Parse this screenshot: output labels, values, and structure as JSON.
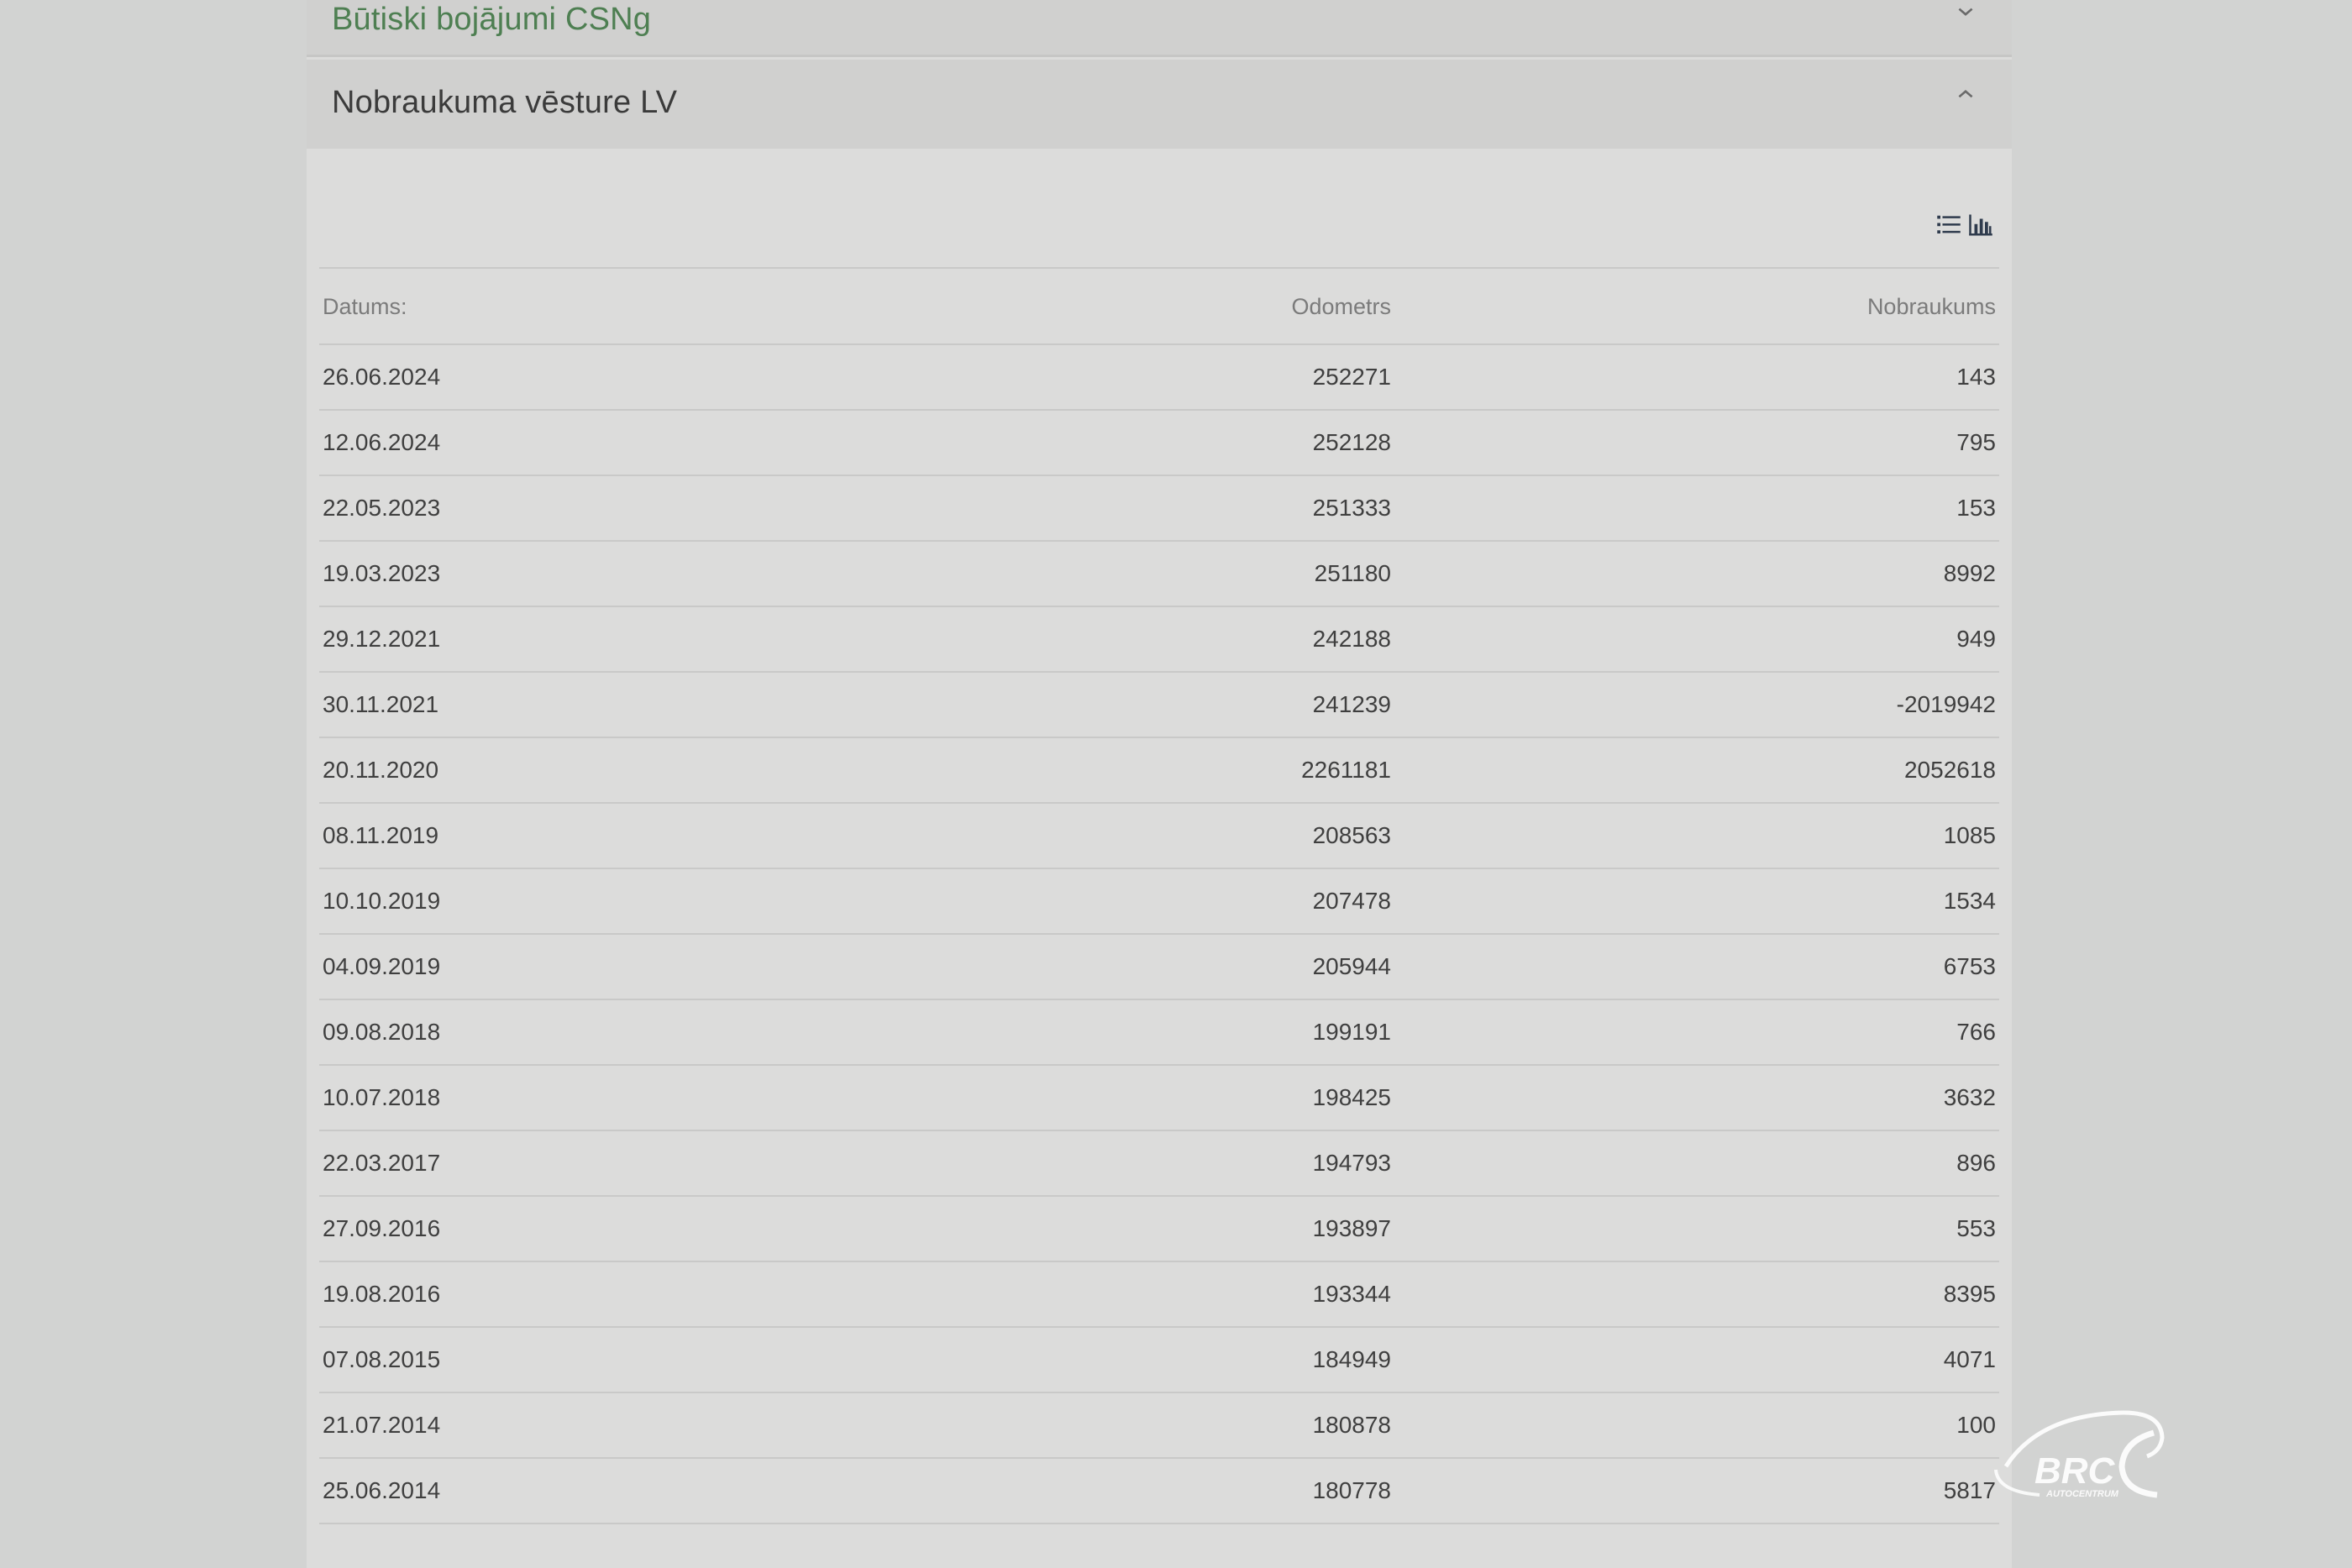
{
  "accordion": {
    "section_damage": {
      "title": "Būtiski bojājumi CSNg"
    },
    "section_mileage": {
      "title": "Nobraukuma vēsture LV"
    }
  },
  "icons": {
    "list_view": "list-icon",
    "chart_view": "bar-chart-icon",
    "collapsed": "chevron-down-icon",
    "expanded": "chevron-up-icon"
  },
  "colors": {
    "accent_green": "#4e7f52",
    "anomaly_red": "#d8474d",
    "icon_dark": "#2f3b4d"
  },
  "table": {
    "headers": {
      "date": "Datums:",
      "odometer": "Odometrs",
      "distance": "Nobraukums"
    },
    "rows": [
      {
        "date": "26.06.2024",
        "odometer": "252271",
        "distance": "143"
      },
      {
        "date": "12.06.2024",
        "odometer": "252128",
        "distance": "795"
      },
      {
        "date": "22.05.2023",
        "odometer": "251333",
        "distance": "153"
      },
      {
        "date": "19.03.2023",
        "odometer": "251180",
        "distance": "8992"
      },
      {
        "date": "29.12.2021",
        "odometer": "242188",
        "distance": "949"
      },
      {
        "date": "30.11.2021",
        "odometer": "241239",
        "distance": "-2019942"
      },
      {
        "date": "20.11.2020",
        "odometer": "2261181",
        "distance": "2052618"
      },
      {
        "date": "08.11.2019",
        "odometer": "208563",
        "distance": "1085"
      },
      {
        "date": "10.10.2019",
        "odometer": "207478",
        "distance": "1534"
      },
      {
        "date": "04.09.2019",
        "odometer": "205944",
        "distance": "6753"
      },
      {
        "date": "09.08.2018",
        "odometer": "199191",
        "distance": "766"
      },
      {
        "date": "10.07.2018",
        "odometer": "198425",
        "distance": "3632"
      },
      {
        "date": "22.03.2017",
        "odometer": "194793",
        "distance": "896"
      },
      {
        "date": "27.09.2016",
        "odometer": "193897",
        "distance": "553"
      },
      {
        "date": "19.08.2016",
        "odometer": "193344",
        "distance": "8395"
      },
      {
        "date": "07.08.2015",
        "odometer": "184949",
        "distance": "4071"
      },
      {
        "date": "21.07.2014",
        "odometer": "180878",
        "distance": "100"
      },
      {
        "date": "25.06.2014",
        "odometer": "180778",
        "distance": "5817"
      }
    ]
  },
  "watermark": {
    "brand": "BRC",
    "subtitle": "AUTOCENTRUM"
  }
}
